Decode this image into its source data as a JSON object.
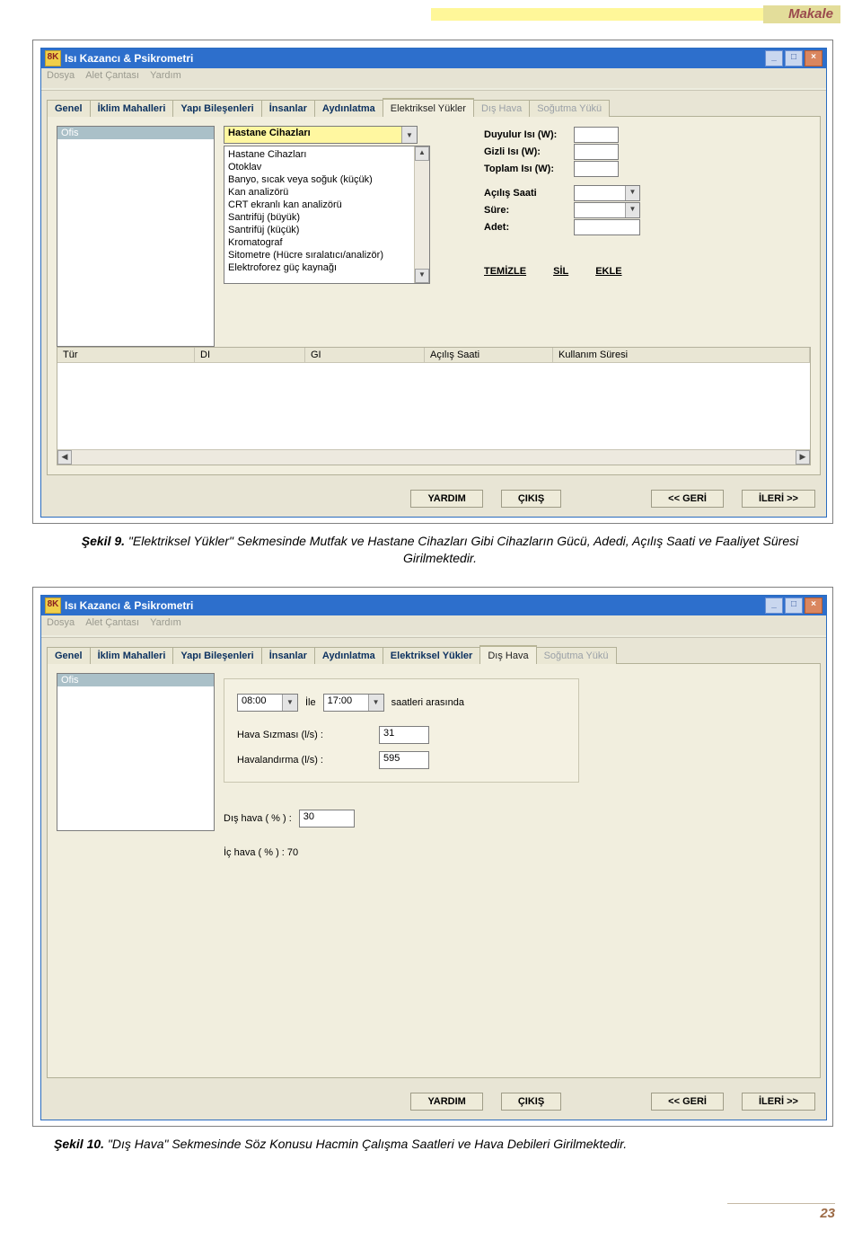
{
  "header": {
    "badge": "Makale"
  },
  "app": {
    "title": "Isı Kazancı & Psikrometri",
    "menus": [
      "Dosya",
      "Alet Çantası",
      "Yardım"
    ]
  },
  "tabs": {
    "items": [
      "Genel",
      "İklim Mahalleri",
      "Yapı Bileşenleri",
      "İnsanlar",
      "Aydınlatma",
      "Elektriksel Yükler",
      "Dış Hava",
      "Soğutma Yükü"
    ],
    "active_fig9": "Elektriksel Yükler",
    "active_fig10": "Dış Hava"
  },
  "fig9": {
    "ofis_header": "Ofis",
    "combo_selected": "Hastane Cihazları",
    "list_items": [
      "Hastane Cihazları",
      "Otoklav",
      "Banyo, sıcak veya soğuk (küçük)",
      "Kan analizörü",
      "CRT ekranlı kan analizörü",
      "Santrifüj (büyük)",
      "Santrifüj (küçük)",
      "Kromatograf",
      "Sitometre (Hücre sıralatıcı/analizör)",
      "Elektroforez güç kaynağı"
    ],
    "labels": {
      "duyulur": "Duyulur Isı (W):",
      "gizli": "Gizli Isı  (W):",
      "toplam": "Toplam Isı (W):",
      "acilis": "Açılış Saati",
      "sure": "Süre:",
      "adet": "Adet:"
    },
    "actions": {
      "temizle": "TEMİZLE",
      "sil": "SİL",
      "ekle": "EKLE"
    },
    "grid_headers": [
      "Tür",
      "DI",
      "GI",
      "Açılış Saati",
      "Kullanım Süresi"
    ]
  },
  "fig10": {
    "ofis_header": "Ofis",
    "time_from": "08:00",
    "ile": "İle",
    "time_to": "17:00",
    "saat_txt": "saatleri arasında",
    "sizma_label": "Hava Sızması (l/s)   :",
    "sizma_val": "31",
    "hava_label": "Havalandırma (l/s)  :",
    "hava_val": "595",
    "dis_label": "Dış hava ( % )  :",
    "dis_val": "30",
    "ic_label": "İç hava ( % ) : 70"
  },
  "bottom": {
    "yardim": "YARDIM",
    "cikis": "ÇIKIŞ",
    "geri": "<<  GERİ",
    "ileri": "İLERİ  >>"
  },
  "captions": {
    "fig9_b": "Şekil 9.",
    "fig9_t": " \"Elektriksel Yükler\" Sekmesinde Mutfak ve Hastane Cihazları Gibi Cihazların Gücü, Adedi, Açılış Saati ve Faaliyet Süresi Girilmektedir.",
    "fig10_b": "Şekil 10.",
    "fig10_t": " \"Dış Hava\" Sekmesinde Söz Konusu Hacmin Çalışma Saatleri ve Hava Debileri Girilmektedir."
  },
  "page_number": "23"
}
